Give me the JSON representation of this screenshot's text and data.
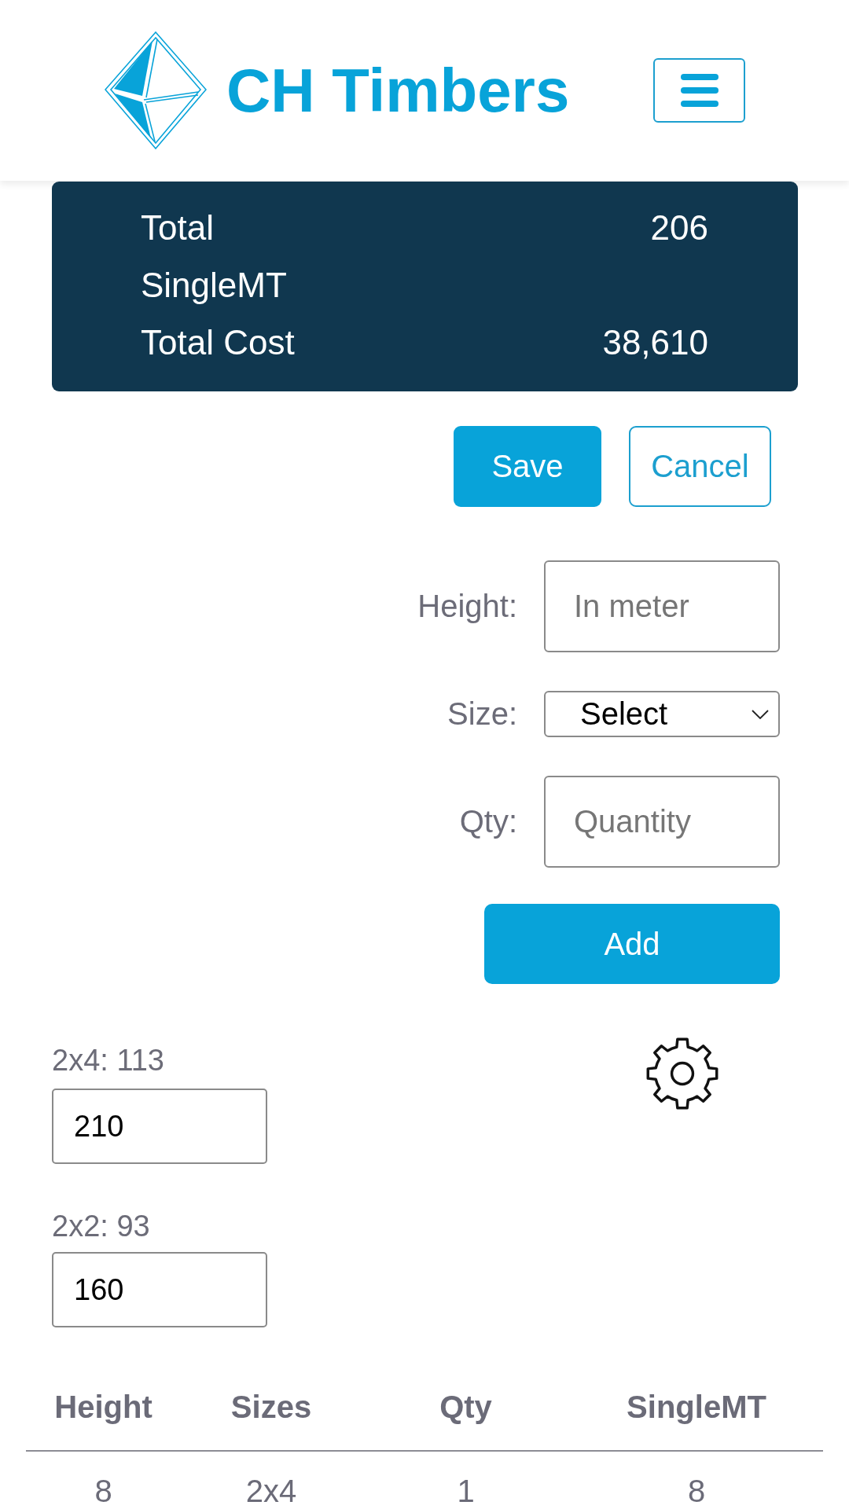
{
  "header": {
    "brand": "CH Timbers"
  },
  "summary": {
    "rows": [
      {
        "label": "Total",
        "value": "206"
      },
      {
        "label": "SingleMT"
      },
      {
        "label": "Total Cost",
        "value": "38,610"
      }
    ]
  },
  "actions": [
    {
      "label": "Save",
      "kind": "primary"
    },
    {
      "label": "Cancel",
      "kind": "outline"
    }
  ],
  "form": {
    "fields": [
      {
        "label": "Height:",
        "kind": "text",
        "placeholder": "In meter"
      },
      {
        "label": "Size:",
        "kind": "select",
        "value": "Select"
      },
      {
        "label": "Qty:",
        "kind": "text",
        "placeholder": "Quantity"
      }
    ],
    "submit": "Add"
  },
  "rates": [
    {
      "label": "2x4: 113",
      "value": "210"
    },
    {
      "label": "2x2: 93",
      "value": "160"
    }
  ],
  "table": {
    "columns": [
      "Height",
      "Sizes",
      "Qty",
      "SingleMT"
    ],
    "rows": [
      [
        "8",
        "2x4",
        "1",
        "8"
      ]
    ]
  }
}
